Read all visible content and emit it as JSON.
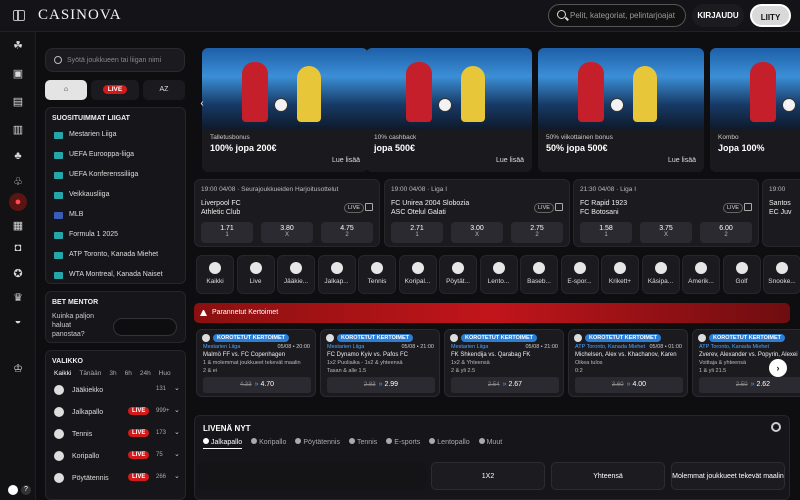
{
  "header": {
    "logo": "CASINOVA",
    "search_placeholder": "Pelit, kategoriat, pelintarjoajat",
    "login_label": "KIRJAUDU",
    "join_label": "LIITY"
  },
  "sidebar": {
    "search_placeholder": "Syötä joukkueen tai liigan nimi",
    "filter_live": "LIVE",
    "filter_az": "AZ",
    "popular_title": "SUOSITUIMMAT LIIGAT",
    "leagues": [
      {
        "label": "Mestarien Liiga",
        "flag_color": "#24a7a8"
      },
      {
        "label": "UEFA Eurooppa-liiga",
        "flag_color": "#24a7a8"
      },
      {
        "label": "UEFA Konferenssiliiga",
        "flag_color": "#24a7a8"
      },
      {
        "label": "Veikkausliiga",
        "flag_color": "#24a7a8"
      },
      {
        "label": "MLB",
        "flag_color": "#3b5bb8"
      },
      {
        "label": "Formula 1 2025",
        "flag_color": "#24a7a8"
      },
      {
        "label": "ATP Toronto, Kanada Miehet",
        "flag_color": "#24a7a8"
      },
      {
        "label": "WTA Montreal, Kanada Naiset",
        "flag_color": "#24a7a8"
      }
    ],
    "bet_mentor_title": "BET MENTOR",
    "bet_mentor_question": "Kuinka paljon haluat panostaa?",
    "menu_title": "VALIKKO",
    "menu_tabs": [
      "Kaikki",
      "Tänään",
      "3h",
      "6h",
      "24h",
      "Huo"
    ],
    "menu_sports": [
      {
        "label": "Jääkiekko",
        "live": "",
        "count": "131"
      },
      {
        "label": "Jalkapallo",
        "live": "LIVE",
        "count": "999+"
      },
      {
        "label": "Tennis",
        "live": "LIVE",
        "count": "173"
      },
      {
        "label": "Koripallo",
        "live": "LIVE",
        "count": "75"
      },
      {
        "label": "Pöytätennis",
        "live": "LIVE",
        "count": "266"
      }
    ]
  },
  "promos": [
    {
      "sub": "Talletusbonus",
      "title": "100% jopa 200€",
      "more": "Lue lisää"
    },
    {
      "sub": "10% cashback",
      "title": "jopa 500€",
      "more": "Lue lisää"
    },
    {
      "sub": "50% viikottainen bonus",
      "title": "50% jopa 500€",
      "more": "Lue lisää"
    },
    {
      "sub": "Kombo",
      "title": "Jopa 100%",
      "more": ""
    }
  ],
  "matches": [
    {
      "header": "19:00  04/08  ·  Seurajoukkueiden Harjoitusottelut",
      "team1": "Liverpool FC",
      "team2": "Athletic Club",
      "live": "LIVE",
      "odds": [
        {
          "v": "1.71",
          "l": "1"
        },
        {
          "v": "3.80",
          "l": "X"
        },
        {
          "v": "4.75",
          "l": "2"
        }
      ]
    },
    {
      "header": "19:00  04/08  ·  Liga I",
      "team1": "FC Unirea 2004 Slobozia",
      "team2": "ASC Otelul Galati",
      "live": "LIVE",
      "odds": [
        {
          "v": "2.71",
          "l": "1"
        },
        {
          "v": "3.00",
          "l": "X"
        },
        {
          "v": "2.75",
          "l": "2"
        }
      ]
    },
    {
      "header": "21:30  04/08  ·  Liga I",
      "team1": "FC Rapid 1923",
      "team2": "FC Botosani",
      "live": "LIVE",
      "odds": [
        {
          "v": "1.58",
          "l": "1"
        },
        {
          "v": "3.75",
          "l": "X"
        },
        {
          "v": "6.00",
          "l": "2"
        }
      ]
    },
    {
      "header": "19:00",
      "team1": "Santos",
      "team2": "EC Juv",
      "live": "",
      "odds": []
    }
  ],
  "sports": [
    "Kaikki",
    "Live",
    "Jääkie...",
    "Jalkap...",
    "Tennis",
    "Koripal...",
    "Pöytät...",
    "Lento...",
    "Baseb...",
    "E-spor...",
    "Krikett+",
    "Käsipa...",
    "Amerik...",
    "Golf",
    "Snooke..."
  ],
  "boost_bar_label": "Parannetut Kertoimet",
  "boosts": [
    {
      "tag": "KOROTETUT KERTOIMET",
      "league": "Mestarien Liiga",
      "date": "05/08 • 20:00",
      "teams": "Malmö FF vs. FC Copenhagen",
      "market": "1 & molemmat joukkueet tekevät maalin",
      "market2": "2 & ei",
      "old": "4.33",
      "new": "4.70"
    },
    {
      "tag": "KOROTETUT KERTOIMET",
      "league": "Mestarien Liiga",
      "date": "05/08 • 21:00",
      "teams": "FC Dynamo Kyiv vs. Pafos FC",
      "market": "1x2 Puoliaika - 1x2 & yhteensä",
      "market2": "Tasan & alle 1.5",
      "old": "2.83",
      "new": "2.99"
    },
    {
      "tag": "KOROTETUT KERTOIMET",
      "league": "Mestarien Liiga",
      "date": "05/08 • 21:00",
      "teams": "FK Shkendija vs. Qarabag FK",
      "market": "1x2 & Yhteensä",
      "market2": "2 & yli 2.5",
      "old": "2.54",
      "new": "2.67"
    },
    {
      "tag": "KOROTETUT KERTOIMET",
      "league": "ATP Toronto, Kanada Miehet",
      "date": "05/08 • 01:00",
      "teams": "Michelsen, Alex vs. Khachanov, Karen",
      "market": "Oikea tulos",
      "market2": "0:2",
      "old": "3.60",
      "new": "4.00"
    },
    {
      "tag": "KOROTETUT KERTOIMET",
      "league": "ATP Toronto, Kanada Miehet",
      "date": "",
      "teams": "Zverev, Alexander vs. Popyrin, Alexei",
      "market": "Voittaja & yhteensä",
      "market2": "1 & yli 21.5",
      "old": "2.50",
      "new": "2.62"
    }
  ],
  "livenow": {
    "title": "LIVENÄ NYT",
    "tabs": [
      "Jalkapallo",
      "Koripallo",
      "Pöytätennis",
      "Tennis",
      "E-sports",
      "Lentopallo",
      "Muut"
    ],
    "markets": [
      "1X2",
      "Yhteensä",
      "Molemmat joukkueet tekevät maalin"
    ]
  }
}
